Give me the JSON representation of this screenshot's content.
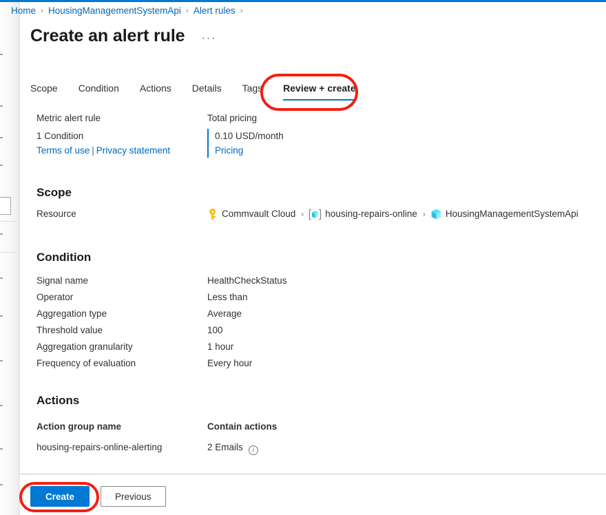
{
  "window": {
    "accent_color": "#0078d4",
    "annotation_color": "#f61e12"
  },
  "breadcrumb": {
    "items": [
      {
        "label": "Home"
      },
      {
        "label": "HousingManagementSystemApi"
      },
      {
        "label": "Alert rules"
      }
    ],
    "separator": "›",
    "trailing_separator": "›"
  },
  "header": {
    "title": "Create an alert rule",
    "more_options": "···"
  },
  "tabs": [
    {
      "label": "Scope",
      "active": false
    },
    {
      "label": "Condition",
      "active": false
    },
    {
      "label": "Actions",
      "active": false
    },
    {
      "label": "Details",
      "active": false
    },
    {
      "label": "Tags",
      "active": false
    },
    {
      "label": "Review + create",
      "active": true
    }
  ],
  "summary": {
    "rule_type_label": "Metric alert rule",
    "condition_count": "1 Condition",
    "terms_link": "Terms of use",
    "links_separator": "|",
    "privacy_link": "Privacy statement",
    "pricing_label": "Total pricing",
    "pricing_amount": "0.10 USD/month",
    "pricing_link": "Pricing"
  },
  "scope": {
    "heading": "Scope",
    "resource_label": "Resource",
    "resource_path": [
      {
        "icon": "key-icon",
        "label": "Commvault Cloud"
      },
      {
        "icon": "resource-group-icon",
        "label": "housing-repairs-online"
      },
      {
        "icon": "app-service-cube-icon",
        "label": "HousingManagementSystemApi"
      }
    ],
    "path_separator": "›"
  },
  "condition": {
    "heading": "Condition",
    "rows": [
      {
        "key": "Signal name",
        "value": "HealthCheckStatus"
      },
      {
        "key": "Operator",
        "value": "Less than"
      },
      {
        "key": "Aggregation type",
        "value": "Average"
      },
      {
        "key": "Threshold value",
        "value": "100"
      },
      {
        "key": "Aggregation granularity",
        "value": "1 hour"
      },
      {
        "key": "Frequency of evaluation",
        "value": "Every hour"
      }
    ]
  },
  "actions": {
    "heading": "Actions",
    "col_group_name": "Action group name",
    "col_contain_actions": "Contain actions",
    "row_group_name": "housing-repairs-online-alerting",
    "row_contain_actions": "2 Emails",
    "info_icon": "info-icon"
  },
  "footer": {
    "create_label": "Create",
    "previous_label": "Previous"
  }
}
